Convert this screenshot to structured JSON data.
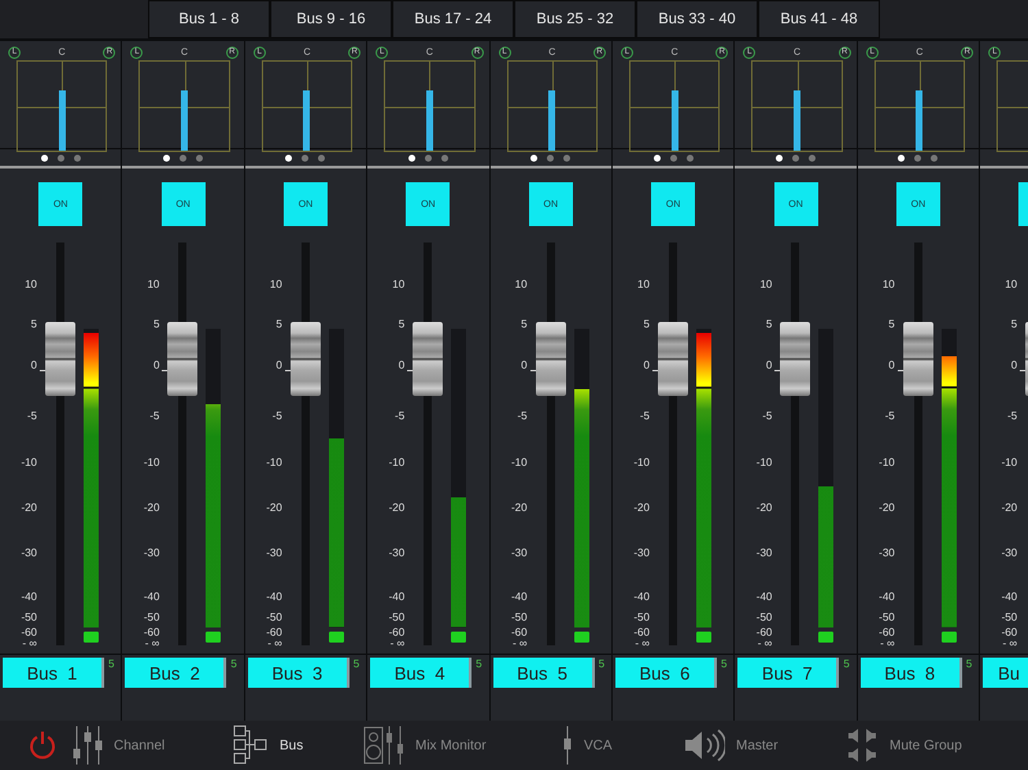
{
  "bank_tabs": [
    {
      "label": "Bus 1 - 8"
    },
    {
      "label": "Bus 9 - 16"
    },
    {
      "label": "Bus 17 - 24"
    },
    {
      "label": "Bus 25 - 32"
    },
    {
      "label": "Bus 33 - 40"
    },
    {
      "label": "Bus 41 - 48"
    }
  ],
  "strips": [
    {
      "pan_labels": [
        "L",
        "C",
        "R"
      ],
      "pages": [
        {
          "selected": true
        },
        {
          "selected": false
        },
        {
          "selected": false
        }
      ],
      "on_label": "ON",
      "on": true,
      "scale": [
        "10",
        "5",
        "0",
        "-5",
        "-10",
        "-20",
        "-30",
        "-40",
        "-50",
        "-60",
        "- ∞"
      ],
      "fader": {
        "level": 0.71
      },
      "meter": {
        "level": 1.0
      },
      "name": "Bus  1",
      "badge": "5"
    },
    {
      "pan_labels": [
        "L",
        "C",
        "R"
      ],
      "pages": [
        {
          "selected": true
        },
        {
          "selected": false
        },
        {
          "selected": false
        }
      ],
      "on_label": "ON",
      "on": true,
      "scale": [
        "10",
        "5",
        "0",
        "-5",
        "-10",
        "-20",
        "-30",
        "-40",
        "-50",
        "-60",
        "- ∞"
      ],
      "fader": {
        "level": 0.71
      },
      "meter": {
        "level": 0.76
      },
      "name": "Bus  2",
      "badge": "5"
    },
    {
      "pan_labels": [
        "L",
        "C",
        "R"
      ],
      "pages": [
        {
          "selected": true
        },
        {
          "selected": false
        },
        {
          "selected": false
        }
      ],
      "on_label": "ON",
      "on": true,
      "scale": [
        "10",
        "5",
        "0",
        "-5",
        "-10",
        "-20",
        "-30",
        "-40",
        "-50",
        "-60",
        "- ∞"
      ],
      "fader": {
        "level": 0.71
      },
      "meter": {
        "level": 0.64
      },
      "name": "Bus  3",
      "badge": "5"
    },
    {
      "pan_labels": [
        "L",
        "C",
        "R"
      ],
      "pages": [
        {
          "selected": true
        },
        {
          "selected": false
        },
        {
          "selected": false
        }
      ],
      "on_label": "ON",
      "on": true,
      "scale": [
        "10",
        "5",
        "0",
        "-5",
        "-10",
        "-20",
        "-30",
        "-40",
        "-50",
        "-60",
        "- ∞"
      ],
      "fader": {
        "level": 0.71
      },
      "meter": {
        "level": 0.44
      },
      "name": "Bus  4",
      "badge": "5"
    },
    {
      "pan_labels": [
        "L",
        "C",
        "R"
      ],
      "pages": [
        {
          "selected": true
        },
        {
          "selected": false
        },
        {
          "selected": false
        }
      ],
      "on_label": "ON",
      "on": true,
      "scale": [
        "10",
        "5",
        "0",
        "-5",
        "-10",
        "-20",
        "-30",
        "-40",
        "-50",
        "-60",
        "- ∞"
      ],
      "fader": {
        "level": 0.71
      },
      "meter": {
        "level": 0.81
      },
      "name": "Bus  5",
      "badge": "5"
    },
    {
      "pan_labels": [
        "L",
        "C",
        "R"
      ],
      "pages": [
        {
          "selected": true
        },
        {
          "selected": false
        },
        {
          "selected": false
        }
      ],
      "on_label": "ON",
      "on": true,
      "scale": [
        "10",
        "5",
        "0",
        "-5",
        "-10",
        "-20",
        "-30",
        "-40",
        "-50",
        "-60",
        "- ∞"
      ],
      "fader": {
        "level": 0.71
      },
      "meter": {
        "level": 1.0
      },
      "name": "Bus  6",
      "badge": "5"
    },
    {
      "pan_labels": [
        "L",
        "C",
        "R"
      ],
      "pages": [
        {
          "selected": true
        },
        {
          "selected": false
        },
        {
          "selected": false
        }
      ],
      "on_label": "ON",
      "on": true,
      "scale": [
        "10",
        "5",
        "0",
        "-5",
        "-10",
        "-20",
        "-30",
        "-40",
        "-50",
        "-60",
        "- ∞"
      ],
      "fader": {
        "level": 0.71
      },
      "meter": {
        "level": 0.48
      },
      "name": "Bus  7",
      "badge": "5"
    },
    {
      "pan_labels": [
        "L",
        "C",
        "R"
      ],
      "pages": [
        {
          "selected": true
        },
        {
          "selected": false
        },
        {
          "selected": false
        }
      ],
      "on_label": "ON",
      "on": true,
      "scale": [
        "10",
        "5",
        "0",
        "-5",
        "-10",
        "-20",
        "-30",
        "-40",
        "-50",
        "-60",
        "- ∞"
      ],
      "fader": {
        "level": 0.71
      },
      "meter": {
        "level": 0.92
      },
      "name": "Bus  8",
      "badge": "5"
    },
    {
      "pan_labels": [
        "L"
      ],
      "on": true,
      "scale": [
        "10",
        "5",
        "0",
        "-5",
        "-10",
        "-20",
        "-30",
        "-40",
        "-50",
        "-60",
        "- ∞"
      ],
      "fader": {
        "level": 0.71
      },
      "name": "Bu"
    }
  ],
  "nav": [
    {
      "kind": "power"
    },
    {
      "kind": "channel",
      "label": "Channel",
      "selected": false
    },
    {
      "kind": "bus",
      "label": "Bus",
      "selected": true
    },
    {
      "kind": "monitor",
      "label": "Mix Monitor",
      "selected": false
    },
    {
      "kind": "vca",
      "label": "VCA",
      "selected": false
    },
    {
      "kind": "master",
      "label": "Master",
      "selected": false
    },
    {
      "kind": "mute",
      "label": "Mute Group",
      "selected": false
    }
  ]
}
